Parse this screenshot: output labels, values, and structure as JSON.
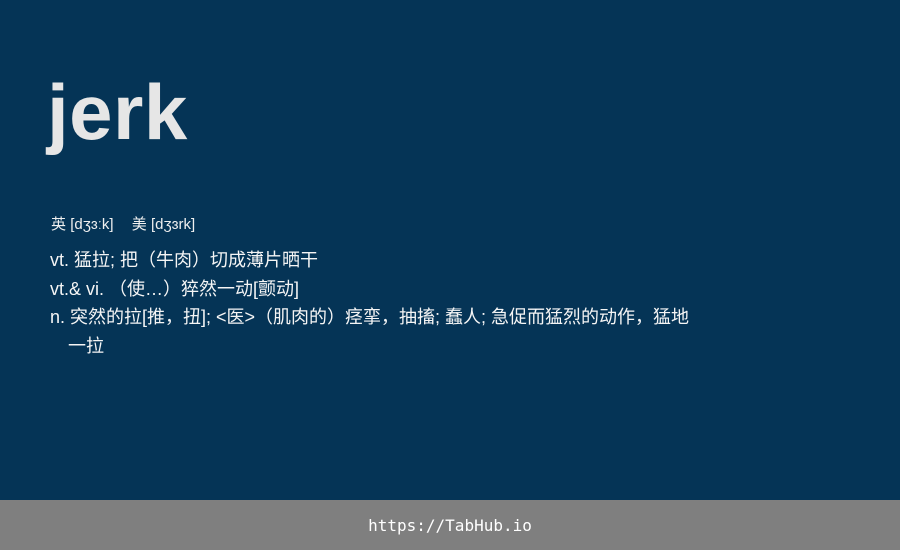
{
  "entry": {
    "word": "jerk",
    "phonetics": [
      {
        "region": "英",
        "ipa": "[dʒɜːk]"
      },
      {
        "region": "美",
        "ipa": "[dʒɜrk]"
      }
    ],
    "definitions": [
      {
        "pos": "vt.",
        "text": "猛拉; 把（牛肉）切成薄片晒干"
      },
      {
        "pos": "vt.& vi.",
        "text": "（使…）猝然一动[颤动]"
      },
      {
        "pos": "n.",
        "text": "突然的拉[推，扭]; <医>（肌肉的）痉挛，抽搐; 蠢人; 急促而猛烈的动作，猛地一拉"
      }
    ]
  },
  "footer": {
    "link": "https://TabHub.io"
  },
  "colors": {
    "background": "#053456",
    "footer_background": "#7f7f7f",
    "text": "#ffffff"
  }
}
